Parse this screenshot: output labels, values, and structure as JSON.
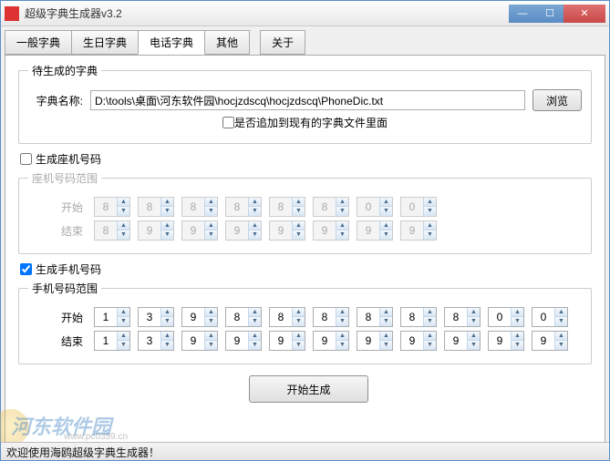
{
  "window": {
    "title": "超级字典生成器v3.2"
  },
  "tabs": {
    "items": [
      {
        "label": "一般字典"
      },
      {
        "label": "生日字典"
      },
      {
        "label": "电话字典"
      },
      {
        "label": "其他"
      },
      {
        "label": "关于"
      }
    ],
    "active": 2
  },
  "dict_group": {
    "legend": "待生成的字典",
    "name_label": "字典名称:",
    "path": "D:\\tools\\桌面\\河东软件园\\hocjzdscq\\hocjzdscq\\PhoneDic.txt",
    "browse": "浏览",
    "append_label": "是否追加到现有的字典文件里面",
    "append_checked": false
  },
  "landline": {
    "enable_label": "生成座机号码",
    "enabled": false,
    "range_legend": "座机号码范围",
    "start_label": "开始",
    "end_label": "结束",
    "start": [
      8,
      8,
      8,
      8,
      8,
      8,
      0,
      0
    ],
    "end": [
      8,
      9,
      9,
      9,
      9,
      9,
      9,
      9
    ]
  },
  "mobile": {
    "enable_label": "生成手机号码",
    "enabled": true,
    "range_legend": "手机号码范围",
    "start_label": "开始",
    "end_label": "结束",
    "start": [
      1,
      3,
      9,
      8,
      8,
      8,
      8,
      8,
      8,
      0,
      0
    ],
    "end": [
      1,
      3,
      9,
      9,
      9,
      9,
      9,
      9,
      9,
      9,
      9
    ]
  },
  "generate_btn": "开始生成",
  "statusbar": "欢迎使用海鸥超级字典生成器！",
  "watermark": {
    "text": "河东软件园",
    "url": "www.pc0359.cn"
  }
}
